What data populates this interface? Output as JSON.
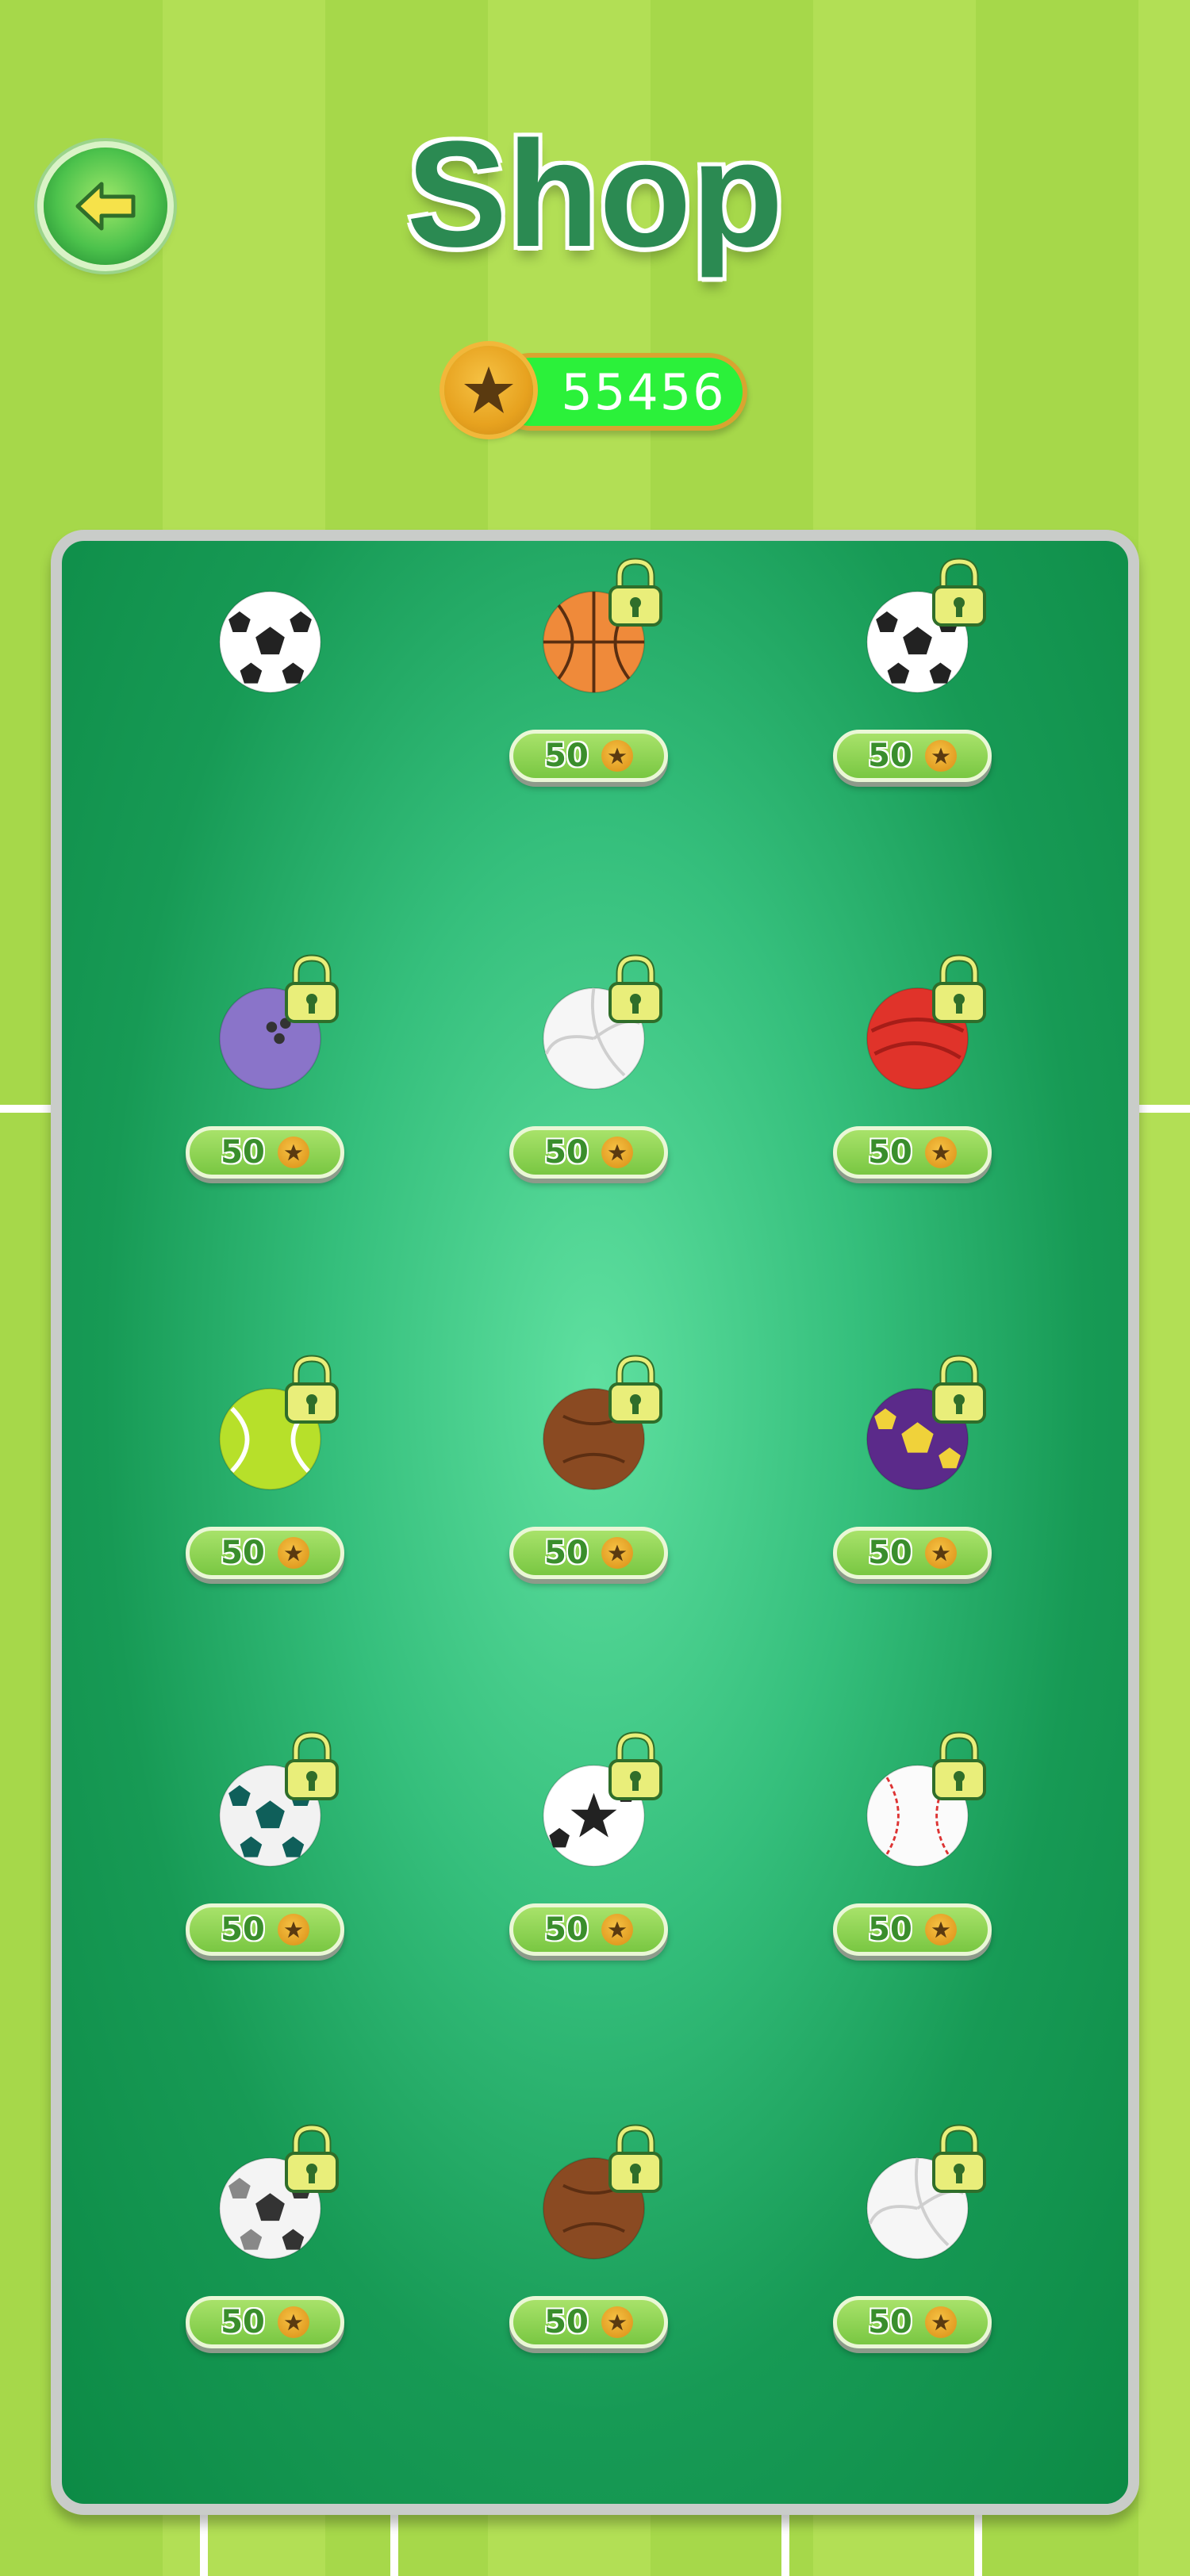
{
  "header": {
    "title": "Shop",
    "back_icon": "back-arrow-icon"
  },
  "wallet": {
    "coins": "55456",
    "coin_icon": "star-coin-icon"
  },
  "colors": {
    "title": "#2b8a52",
    "panel": "#179a55",
    "coin_bar": "#2bf13a",
    "price_button": "#8fd452"
  },
  "balls": [
    {
      "name": "classic-soccer-ball",
      "locked": false,
      "price": ""
    },
    {
      "name": "basketball",
      "locked": true,
      "price": "50"
    },
    {
      "name": "soccer-ball",
      "locked": true,
      "price": "50"
    },
    {
      "name": "bowling-ball",
      "locked": true,
      "price": "50"
    },
    {
      "name": "white-volleyball",
      "locked": true,
      "price": "50"
    },
    {
      "name": "red-ball",
      "locked": true,
      "price": "50"
    },
    {
      "name": "tennis-ball",
      "locked": true,
      "price": "50"
    },
    {
      "name": "leather-football",
      "locked": true,
      "price": "50"
    },
    {
      "name": "purple-yellow-soccer-ball",
      "locked": true,
      "price": "50"
    },
    {
      "name": "teal-soccer-ball",
      "locked": true,
      "price": "50"
    },
    {
      "name": "star-soccer-ball",
      "locked": true,
      "price": "50"
    },
    {
      "name": "baseball",
      "locked": true,
      "price": "50"
    },
    {
      "name": "grey-soccer-ball",
      "locked": true,
      "price": "50"
    },
    {
      "name": "brown-ball",
      "locked": true,
      "price": "50"
    },
    {
      "name": "volleyball",
      "locked": true,
      "price": "50"
    }
  ]
}
